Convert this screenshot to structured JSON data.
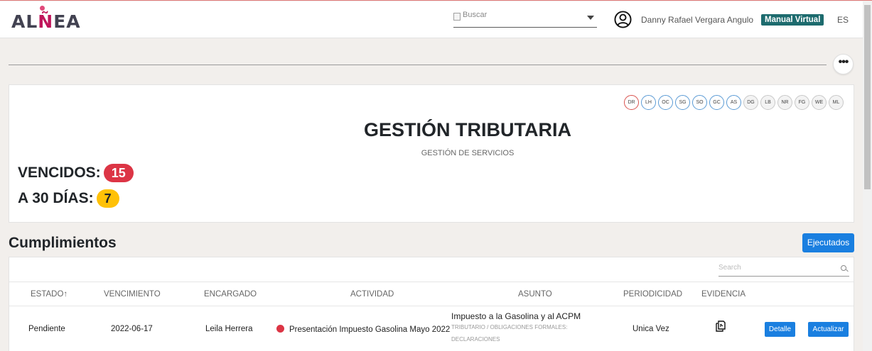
{
  "header": {
    "logo_text_left": "AL",
    "logo_text_mid": "Ñ",
    "logo_text_right": "EA",
    "search_placeholder": "Buscar",
    "user_name": "Danny Rafael Vergara Angulo",
    "manual_label": "Manual Virtual",
    "language": "ES",
    "icons": {
      "user": "user-circle-icon",
      "dropdown": "caret-down-icon",
      "search_image": "broken-image-icon"
    }
  },
  "toolbar": {
    "more_label": "•••"
  },
  "summary": {
    "badges": [
      "DR",
      "LH",
      "OC",
      "SG",
      "SO",
      "GC",
      "AS",
      "DG",
      "LB",
      "NR",
      "FG",
      "WE",
      "ML"
    ],
    "title": "GESTIÓN TRIBUTARIA",
    "subtitle": "GESTIÓN DE SERVICIOS",
    "overdue_label": "VENCIDOS:",
    "overdue_count": "15",
    "upcoming_label": "A 30 DÍAS:",
    "upcoming_count": "7",
    "colors": {
      "overdue": "#dc3545",
      "upcoming": "#ffc107"
    }
  },
  "section": {
    "title": "Cumplimientos",
    "executed_button": "Ejecutados"
  },
  "table": {
    "search_placeholder": "Search",
    "columns": [
      "ESTADO↑",
      "VENCIMIENTO",
      "ENCARGADO",
      "ACTIVIDAD",
      "ASUNTO",
      "PERIODICIDAD",
      "EVIDENCIA"
    ],
    "rows": [
      {
        "estado": "Pendiente",
        "vencimiento": "2022-06-17",
        "encargado": "Leila Herrera",
        "actividad": "Presentación Impuesto Gasolina Mayo 2022",
        "asunto": "Impuesto a la Gasolina y al ACPM",
        "asunto_categoria_1": "TRIBUTARIO / OBLIGACIONES FORMALES:",
        "asunto_categoria_2": "DECLARACIONES",
        "periodicidad": "Unica Vez",
        "evidencia_icon": "document-copy-icon",
        "detalle_label": "Detalle",
        "actualizar_label": "Actualizar"
      }
    ]
  }
}
